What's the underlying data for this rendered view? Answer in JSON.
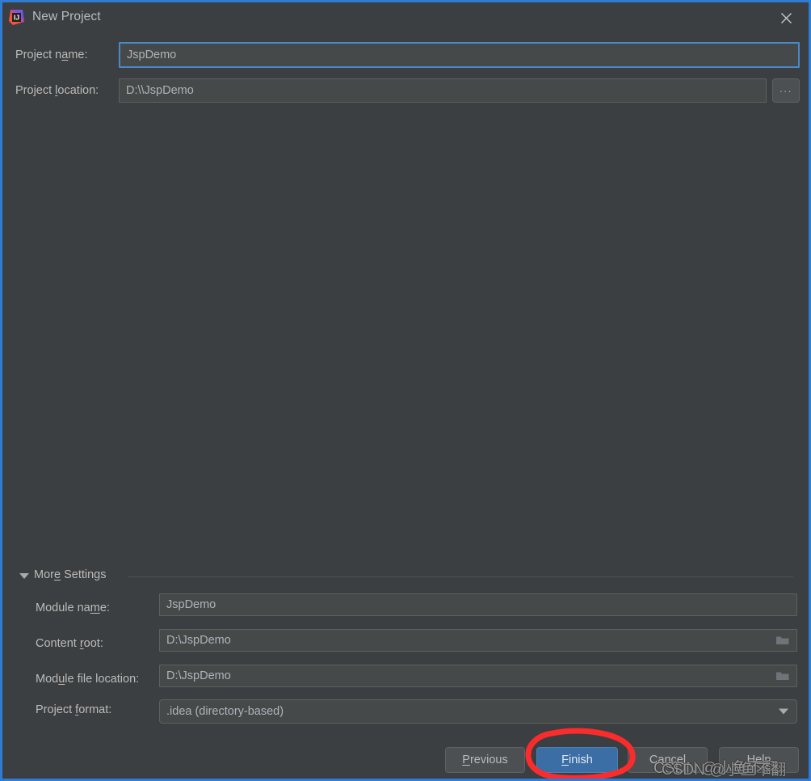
{
  "window": {
    "title": "New Project",
    "logo_icon": "intellij-idea-logo",
    "close_icon": "close-icon",
    "border_color": "#2e7cd6",
    "background_color": "#3c3f41"
  },
  "form": {
    "project_name": {
      "label_pre": "Project n",
      "label_mn": "a",
      "label_post": "me:",
      "value": "JspDemo",
      "focused": true
    },
    "project_location": {
      "label_pre": "Project ",
      "label_mn": "l",
      "label_post": "ocation:",
      "value": "D:\\\\JspDemo",
      "browse_label": "...",
      "browse_icon": "ellipsis-icon"
    }
  },
  "more_settings": {
    "label_pre": "Mor",
    "label_mn": "e",
    "label_post": " Settings",
    "expanded": true,
    "collapse_icon": "triangle-down-icon",
    "fields": {
      "module_name": {
        "label_pre": "Module na",
        "label_mn": "m",
        "label_post": "e:",
        "value": "JspDemo"
      },
      "content_root": {
        "label_pre": "Content ",
        "label_mn": "r",
        "label_post": "oot:",
        "value": "D:\\JspDemo",
        "icon": "folder-icon"
      },
      "module_file_location": {
        "label_pre": "Mod",
        "label_mn": "u",
        "label_post": "le file location:",
        "value": "D:\\JspDemo",
        "icon": "folder-icon"
      },
      "project_format": {
        "label_pre": "Project ",
        "label_mn": "f",
        "label_post": "ormat:",
        "value": ".idea (directory-based)",
        "icon": "chevron-down-icon"
      }
    }
  },
  "buttons": {
    "previous": {
      "pre": "",
      "mn": "P",
      "post": "revious"
    },
    "finish": {
      "pre": "",
      "mn": "F",
      "post": "inish",
      "primary": true,
      "color": "#3c6ea6"
    },
    "cancel": {
      "pre": "Cancel",
      "mn": "",
      "post": ""
    },
    "help": {
      "pre": "",
      "mn": "H",
      "post": "elp"
    }
  },
  "annotation": {
    "shape": "hand-drawn-circle",
    "color": "#fc2c2c",
    "target": "finish-button"
  },
  "watermark": {
    "line_a": "CSDN @小鱼不翻",
    "line_b": "CSDN @小鱼不翻"
  }
}
